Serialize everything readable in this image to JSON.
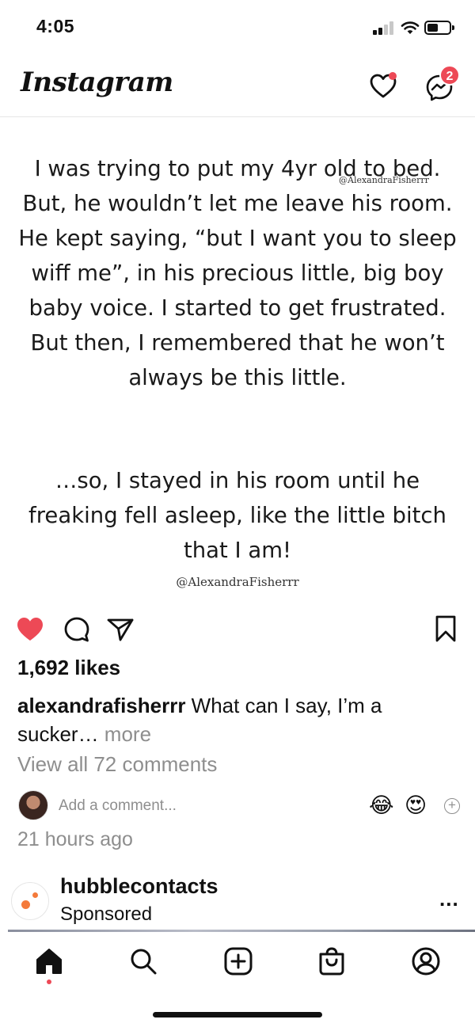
{
  "status_bar": {
    "time": "4:05"
  },
  "header": {
    "logo": "Instagram",
    "messages_badge": "2",
    "icons": [
      "heart-icon",
      "messenger-icon"
    ]
  },
  "post": {
    "image_text": "I was trying to put my 4yr old to bed. But, he wouldn’t let me leave his room. He kept saying, “but I want you to sleep wiff me”, in his precious little, big boy baby voice. I started to get frustrated. But then, I remembered that he won’t always be this little.",
    "image_text_2": "…so, I stayed in his room until he freaking fell asleep, like the little bitch that I am!",
    "watermark_top": "@AlexandraFisherrr",
    "watermark_bottom": "@AlexandraFisherrr",
    "likes": "1,692 likes",
    "caption_user": "alexandrafisherrr",
    "caption_text": " What can I say, I’m a sucker…",
    "caption_more": " more",
    "view_comments": "View all 72 comments",
    "add_comment_placeholder": "Add a comment...",
    "quick_emojis": [
      "😂",
      "😍"
    ],
    "time_ago": "21 hours ago",
    "liked": true
  },
  "sponsored_post": {
    "username": "hubblecontacts",
    "label": "Sponsored",
    "menu": "..."
  },
  "bottom_nav": {
    "items": [
      "home-icon",
      "search-icon",
      "new-post-icon",
      "shop-icon",
      "profile-icon"
    ],
    "active": "home-icon"
  },
  "colors": {
    "like_red": "#ed4956",
    "muted_text": "#8e8e8e",
    "brand_orange": "#f47a3b"
  }
}
